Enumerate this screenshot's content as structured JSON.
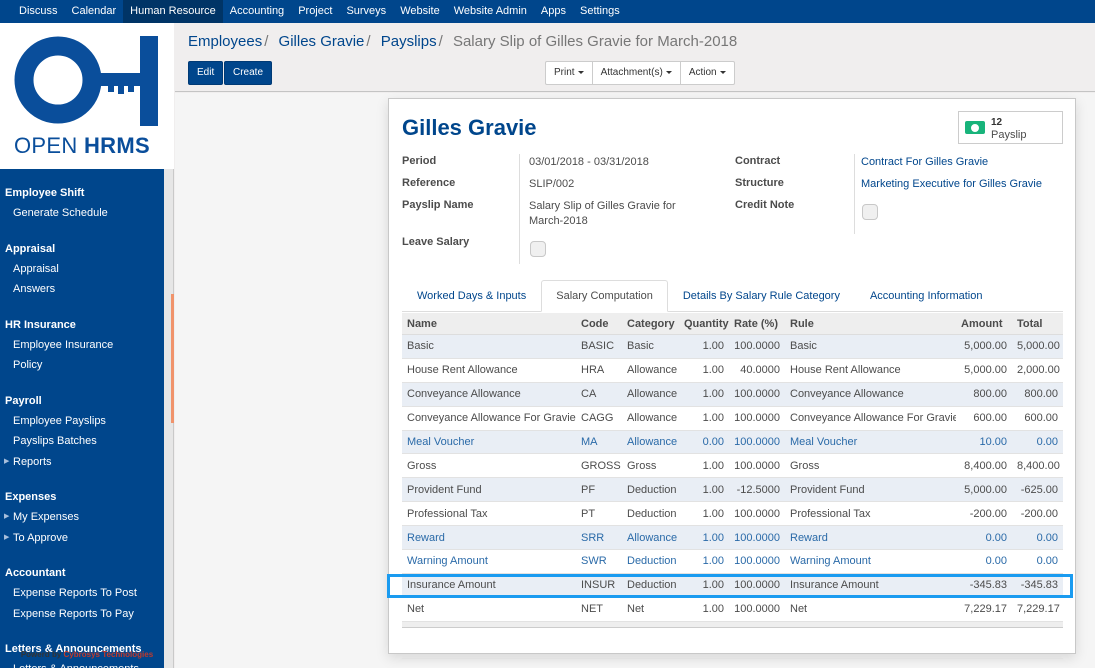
{
  "topnav": {
    "items": [
      "Discuss",
      "Calendar",
      "Human Resource",
      "Accounting",
      "Project",
      "Surveys",
      "Website",
      "Website Admin",
      "Apps",
      "Settings"
    ],
    "active": "Human Resource"
  },
  "logo": {
    "text_light": "OPEN ",
    "text_bold": "HRMS"
  },
  "sidebar": {
    "sections": [
      {
        "title": "Employee Shift",
        "items": [
          {
            "label": "Generate Schedule",
            "caret": false
          }
        ]
      },
      {
        "title": "Appraisal",
        "items": [
          {
            "label": "Appraisal",
            "caret": false
          },
          {
            "label": "Answers",
            "caret": false
          }
        ]
      },
      {
        "title": "HR Insurance",
        "items": [
          {
            "label": "Employee Insurance",
            "caret": false
          },
          {
            "label": "Policy",
            "caret": false
          }
        ]
      },
      {
        "title": "Payroll",
        "items": [
          {
            "label": "Employee Payslips",
            "caret": false
          },
          {
            "label": "Payslips Batches",
            "caret": false
          },
          {
            "label": "Reports",
            "caret": true
          }
        ]
      },
      {
        "title": "Expenses",
        "items": [
          {
            "label": "My Expenses",
            "caret": true
          },
          {
            "label": "To Approve",
            "caret": true
          }
        ]
      },
      {
        "title": "Accountant",
        "items": [
          {
            "label": "Expense Reports To Post",
            "caret": false
          },
          {
            "label": "Expense Reports To Pay",
            "caret": false
          }
        ]
      },
      {
        "title": "Letters & Announcements",
        "items": [
          {
            "label": "Letters & Announcements",
            "caret": false
          }
        ]
      }
    ],
    "footer_prefix": "Powerd by ",
    "footer_brand": "Cybrosys Technologies"
  },
  "breadcrumb": {
    "links": [
      "Employees",
      "Gilles Gravie",
      "Payslips"
    ],
    "current": "Salary Slip of Gilles Gravie for March-2018",
    "separator": "/"
  },
  "toolbar": {
    "edit_label": "Edit",
    "create_label": "Create",
    "print_label": "Print",
    "attachments_label": "Attachment(s)",
    "action_label": "Action"
  },
  "form": {
    "employee_name": "Gilles Gravie",
    "stat_button": {
      "count": "12",
      "label": "Payslip",
      "icon": "money-icon"
    },
    "left_fields": {
      "period_label": "Period",
      "period_value": "03/01/2018 - 03/31/2018",
      "reference_label": "Reference",
      "reference_value": "SLIP/002",
      "payslip_name_label": "Payslip Name",
      "payslip_name_value": "Salary Slip of Gilles Gravie for March-2018",
      "leave_salary_label": "Leave Salary",
      "leave_salary_checked": false
    },
    "right_fields": {
      "contract_label": "Contract",
      "contract_value": "Contract For Gilles Gravie",
      "structure_label": "Structure",
      "structure_value": "Marketing Executive for Gilles Gravie",
      "credit_note_label": "Credit Note",
      "credit_note_checked": false
    }
  },
  "tabs": {
    "items": [
      "Worked Days & Inputs",
      "Salary Computation",
      "Details By Salary Rule Category",
      "Accounting Information"
    ],
    "active": "Salary Computation"
  },
  "salary_table": {
    "columns": [
      "Name",
      "Code",
      "Category",
      "Quantity",
      "Rate (%)",
      "Rule",
      "Amount",
      "Total"
    ],
    "rows": [
      {
        "name": "Basic",
        "code": "BASIC",
        "category": "Basic",
        "quantity": "1.00",
        "rate": "100.0000",
        "rule": "Basic",
        "amount": "5,000.00",
        "total": "5,000.00",
        "muted": false
      },
      {
        "name": "House Rent Allowance",
        "code": "HRA",
        "category": "Allowance",
        "quantity": "1.00",
        "rate": "40.0000",
        "rule": "House Rent Allowance",
        "amount": "5,000.00",
        "total": "2,000.00",
        "muted": false
      },
      {
        "name": "Conveyance Allowance",
        "code": "CA",
        "category": "Allowance",
        "quantity": "1.00",
        "rate": "100.0000",
        "rule": "Conveyance Allowance",
        "amount": "800.00",
        "total": "800.00",
        "muted": false
      },
      {
        "name": "Conveyance Allowance For Gravie",
        "code": "CAGG",
        "category": "Allowance",
        "quantity": "1.00",
        "rate": "100.0000",
        "rule": "Conveyance Allowance For Gravie",
        "amount": "600.00",
        "total": "600.00",
        "muted": false
      },
      {
        "name": "Meal Voucher",
        "code": "MA",
        "category": "Allowance",
        "quantity": "0.00",
        "rate": "100.0000",
        "rule": "Meal Voucher",
        "amount": "10.00",
        "total": "0.00",
        "muted": true
      },
      {
        "name": "Gross",
        "code": "GROSS",
        "category": "Gross",
        "quantity": "1.00",
        "rate": "100.0000",
        "rule": "Gross",
        "amount": "8,400.00",
        "total": "8,400.00",
        "muted": false
      },
      {
        "name": "Provident Fund",
        "code": "PF",
        "category": "Deduction",
        "quantity": "1.00",
        "rate": "-12.5000",
        "rule": "Provident Fund",
        "amount": "5,000.00",
        "total": "-625.00",
        "muted": false
      },
      {
        "name": "Professional Tax",
        "code": "PT",
        "category": "Deduction",
        "quantity": "1.00",
        "rate": "100.0000",
        "rule": "Professional Tax",
        "amount": "-200.00",
        "total": "-200.00",
        "muted": false
      },
      {
        "name": "Reward",
        "code": "SRR",
        "category": "Allowance",
        "quantity": "1.00",
        "rate": "100.0000",
        "rule": "Reward",
        "amount": "0.00",
        "total": "0.00",
        "muted": true
      },
      {
        "name": "Warning Amount",
        "code": "SWR",
        "category": "Deduction",
        "quantity": "1.00",
        "rate": "100.0000",
        "rule": "Warning Amount",
        "amount": "0.00",
        "total": "0.00",
        "muted": true
      },
      {
        "name": "Insurance Amount",
        "code": "INSUR",
        "category": "Deduction",
        "quantity": "1.00",
        "rate": "100.0000",
        "rule": "Insurance Amount",
        "amount": "-345.83",
        "total": "-345.83",
        "muted": false,
        "highlighted": true
      },
      {
        "name": "Net",
        "code": "NET",
        "category": "Net",
        "quantity": "1.00",
        "rate": "100.0000",
        "rule": "Net",
        "amount": "7,229.17",
        "total": "7,229.17",
        "muted": false
      }
    ]
  },
  "colors": {
    "brand": "#00468c",
    "link": "#2a6aa8",
    "highlight": "#1a9bf0",
    "stat_icon": "#18b47b",
    "footer_brand": "#c0392b"
  }
}
